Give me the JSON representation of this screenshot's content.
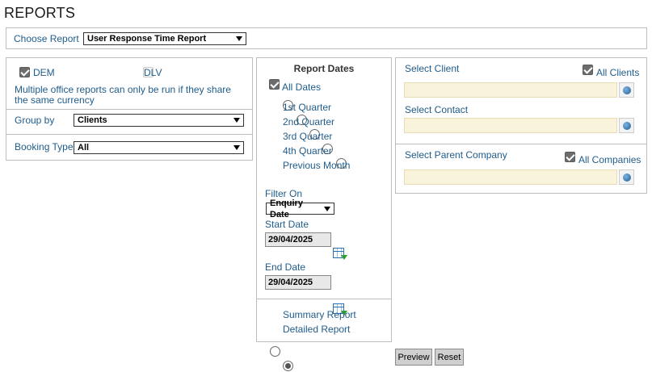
{
  "page": {
    "title": "REPORTS"
  },
  "choose_report": {
    "label": "Choose Report",
    "selected": "User Response Time Report"
  },
  "office": {
    "dem_label": "DEM",
    "dem_checked": true,
    "dlv_label": "DLV",
    "dlv_checked": false,
    "note": "Multiple office reports can only be run if they share the same currency"
  },
  "group_by": {
    "label": "Group by",
    "selected": "Clients"
  },
  "booking_type": {
    "label": "Booking Type",
    "selected": "All"
  },
  "report_dates": {
    "heading": "Report Dates",
    "all_dates_label": "All Dates",
    "all_dates_checked": true,
    "options": [
      "1st Quarter",
      "2nd Quarter",
      "3rd Quarter",
      "4th Quarter",
      "Previous Month"
    ],
    "filter_on_label": "Filter On",
    "filter_on_selected": "Enquiry Date",
    "start_date_label": "Start Date",
    "start_date_value": "29/04/2025",
    "end_date_label": "End Date",
    "end_date_value": "29/04/2025"
  },
  "report_format": {
    "summary_label": "Summary Report",
    "detailed_label": "Detailed Report",
    "selected": "Detailed Report"
  },
  "client": {
    "select_client_label": "Select Client",
    "all_clients_label": "All Clients",
    "all_clients_checked": true,
    "client_value": "",
    "select_contact_label": "Select Contact",
    "contact_value": "",
    "select_parent_label": "Select Parent Company",
    "all_companies_label": "All Companies",
    "all_companies_checked": true,
    "parent_value": ""
  },
  "actions": {
    "preview_label": "Preview",
    "reset_label": "Reset"
  },
  "colors": {
    "label_blue": "#1f5c8b",
    "lookup_bg": "#faf3dc",
    "button_bg": "#d0d0d0"
  },
  "icons": [
    "globe-icon",
    "calendar-icon",
    "dropdown-arrow-icon"
  ]
}
